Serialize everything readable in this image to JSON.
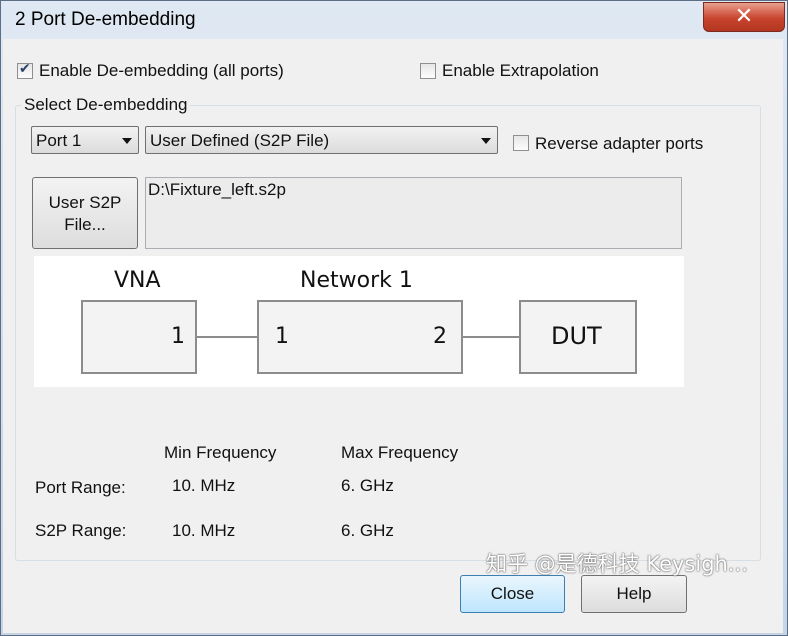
{
  "window": {
    "title": "2 Port De-embedding",
    "close_glyph": "✕"
  },
  "enable_deembedding": {
    "label": "Enable De-embedding (all ports)",
    "checked": true
  },
  "enable_extrapolation": {
    "label": "Enable Extrapolation",
    "checked": false
  },
  "group": {
    "title": "Select De-embedding",
    "port_select": {
      "value": "Port 1"
    },
    "type_select": {
      "value": "User Defined (S2P File)"
    },
    "reverse_adapter": {
      "label": "Reverse adapter ports",
      "checked": false
    },
    "user_s2p_button": {
      "line1": "User S2P",
      "line2": "File..."
    },
    "file_path": "D:\\Fixture_left.s2p"
  },
  "diagram": {
    "vna_label": "VNA",
    "vna_port": "1",
    "network_label": "Network 1",
    "network_port_left": "1",
    "network_port_right": "2",
    "dut_label": "DUT"
  },
  "ranges": {
    "header_min": "Min Frequency",
    "header_max": "Max Frequency",
    "rows": [
      {
        "label": "Port Range:",
        "min": "10. MHz",
        "max": "6. GHz"
      },
      {
        "label": "S2P Range:",
        "min": "10. MHz",
        "max": "6. GHz"
      }
    ]
  },
  "buttons": {
    "close": "Close",
    "help": "Help"
  },
  "watermark": "知乎 @是德科技 Keysigh..."
}
